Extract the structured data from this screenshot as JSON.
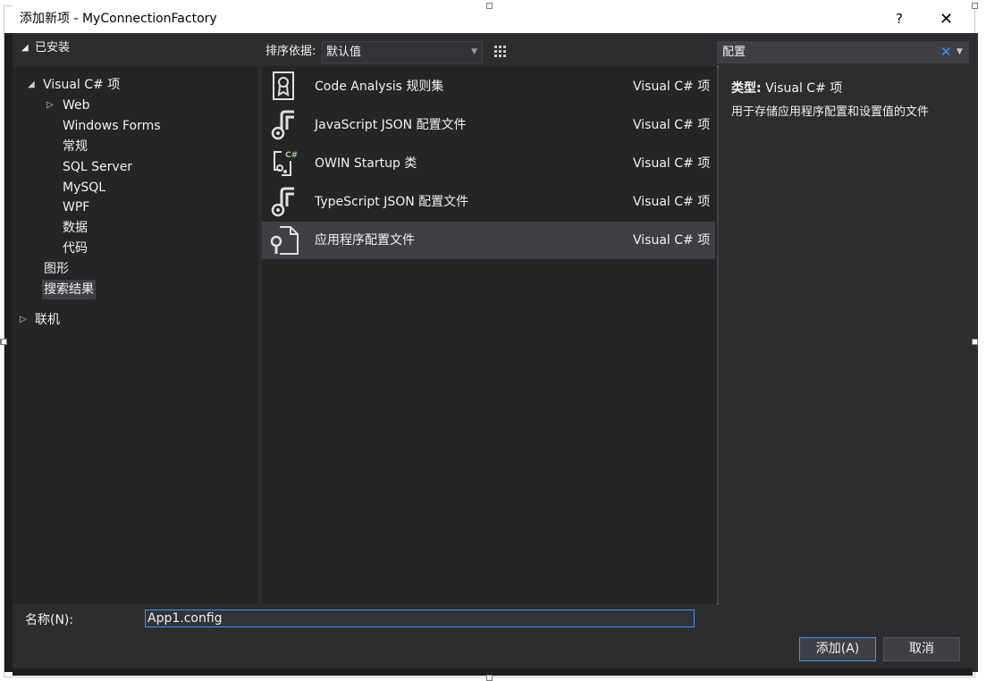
{
  "window": {
    "title": "添加新项 - MyConnectionFactory",
    "help": "?",
    "close": "✕"
  },
  "left_header": "已安装",
  "toolbar": {
    "sort_label": "排序依据:",
    "sort_value": "默认值"
  },
  "search": {
    "value": "配置",
    "clear": "✕",
    "dropdown": "▼"
  },
  "tree": {
    "visual_csharp": "Visual C# 项",
    "web": "Web",
    "windows_forms": "Windows Forms",
    "general": "常规",
    "sql_server": "SQL Server",
    "mysql": "MySQL",
    "wpf": "WPF",
    "data": "数据",
    "code": "代码",
    "graphics": "图形",
    "search_results": "搜索结果",
    "online": "联机"
  },
  "templates": [
    {
      "name": "Code Analysis 规则集",
      "type": "Visual C# 项",
      "icon": "ribbon-certificate-icon"
    },
    {
      "name": "JavaScript JSON 配置文件",
      "type": "Visual C# 项",
      "icon": "json-config-icon"
    },
    {
      "name": "OWIN Startup 类",
      "type": "Visual C# 项",
      "icon": "owin-startup-icon"
    },
    {
      "name": "TypeScript JSON 配置文件",
      "type": "Visual C# 项",
      "icon": "json-config-icon"
    },
    {
      "name": "应用程序配置文件",
      "type": "Visual C# 项",
      "icon": "wrench-document-icon"
    }
  ],
  "detail": {
    "type_label": "类型:",
    "type_value": "Visual C# 项",
    "description": "用于存储应用程序配置和设置值的文件"
  },
  "bottom": {
    "name_label": "名称(N):",
    "name_value": "App1.config",
    "add_button": "添加(A)",
    "cancel_button": "取消"
  }
}
